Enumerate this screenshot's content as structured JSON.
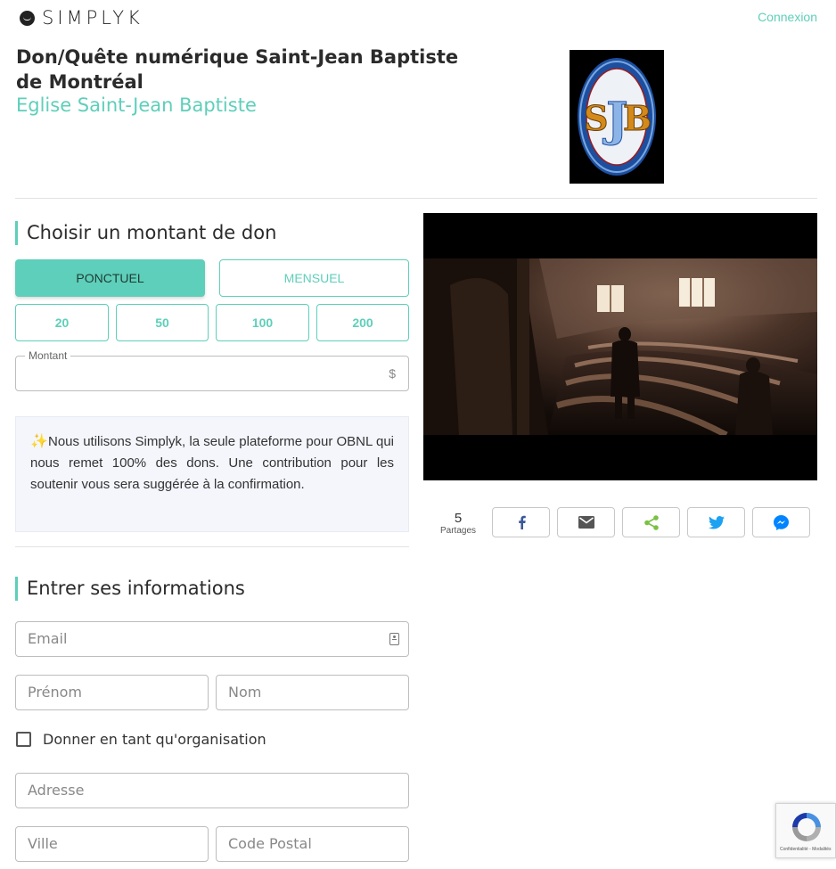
{
  "header": {
    "brand": "SIMPLYK",
    "login_label": "Connexion"
  },
  "campaign": {
    "title": "Don/Quête numérique Saint-Jean Baptiste de Montréal",
    "organization": "Eglise Saint-Jean Baptiste",
    "logo_text": "SJB"
  },
  "donation": {
    "section_title": "Choisir un montant de don",
    "frequency": [
      {
        "label": "PONCTUEL",
        "selected": true
      },
      {
        "label": "MENSUEL",
        "selected": false
      }
    ],
    "amounts": [
      "20",
      "50",
      "100",
      "200"
    ],
    "amount_field_label": "Montant",
    "currency_symbol": "$",
    "info_text": "Nous utilisons Simplyk, la seule plateforme pour OBNL qui nous remet 100% des dons. Une contribution pour les soutenir vous sera suggérée à la confirmation."
  },
  "share": {
    "count": "5",
    "count_label": "Partages",
    "buttons": [
      {
        "icon": "facebook-icon",
        "color": "#3b5998"
      },
      {
        "icon": "mail-icon",
        "color": "#555555"
      },
      {
        "icon": "share-icon",
        "color": "#7ac143"
      },
      {
        "icon": "twitter-icon",
        "color": "#1da1f2"
      },
      {
        "icon": "messenger-icon",
        "color": "#0084ff"
      }
    ]
  },
  "info_form": {
    "section_title": "Entrer ses informations",
    "email_placeholder": "Email",
    "firstname_placeholder": "Prénom",
    "lastname_placeholder": "Nom",
    "organization_checkbox_label": "Donner en tant qu'organisation",
    "address_placeholder": "Adresse",
    "city_placeholder": "Ville",
    "postal_placeholder": "Code Postal"
  },
  "recaptcha": {
    "footer_text": "Confidentialité - Modalités"
  },
  "colors": {
    "accent": "#5ecfba",
    "text": "#2b2b2b",
    "info_bg": "#f4f6fc"
  }
}
